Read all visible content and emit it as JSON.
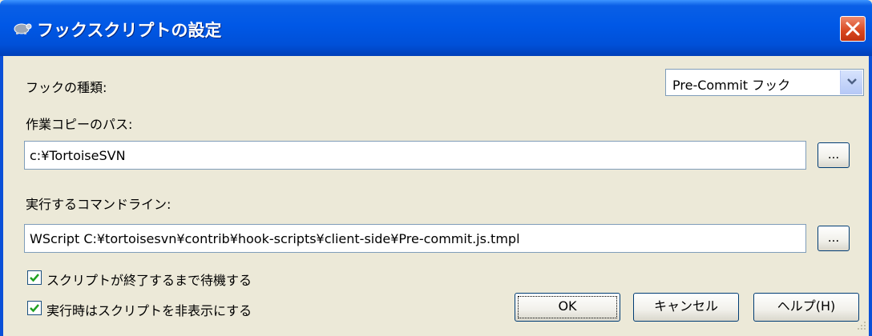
{
  "window": {
    "title": "フックスクリプトの設定",
    "close_icon": "close-icon",
    "app_icon": "tortoisesvn-icon"
  },
  "form": {
    "hook_type_label": "フックの種類:",
    "hook_type_selected": "Pre-Commit フック",
    "working_copy_label": "作業コピーのパス:",
    "working_copy_value": "c:¥TortoiseSVN",
    "command_line_label": "実行するコマンドライン:",
    "command_line_value": "WScript C:¥tortoisesvn¥contrib¥hook-scripts¥client-side¥Pre-commit.js.tmpl",
    "browse_label": "...",
    "wait_checkbox": {
      "label": "スクリプトが終了するまで待機する",
      "checked": true
    },
    "hide_checkbox": {
      "label": "実行時はスクリプトを非表示にする",
      "checked": true
    }
  },
  "buttons": {
    "ok": "OK",
    "cancel": "キャンセル",
    "help": "ヘルプ(H)"
  },
  "colors": {
    "titlebar": "#0058e6",
    "dialog_bg": "#ece9d8",
    "close_button": "#d8461e",
    "checkmark": "#21a121"
  }
}
